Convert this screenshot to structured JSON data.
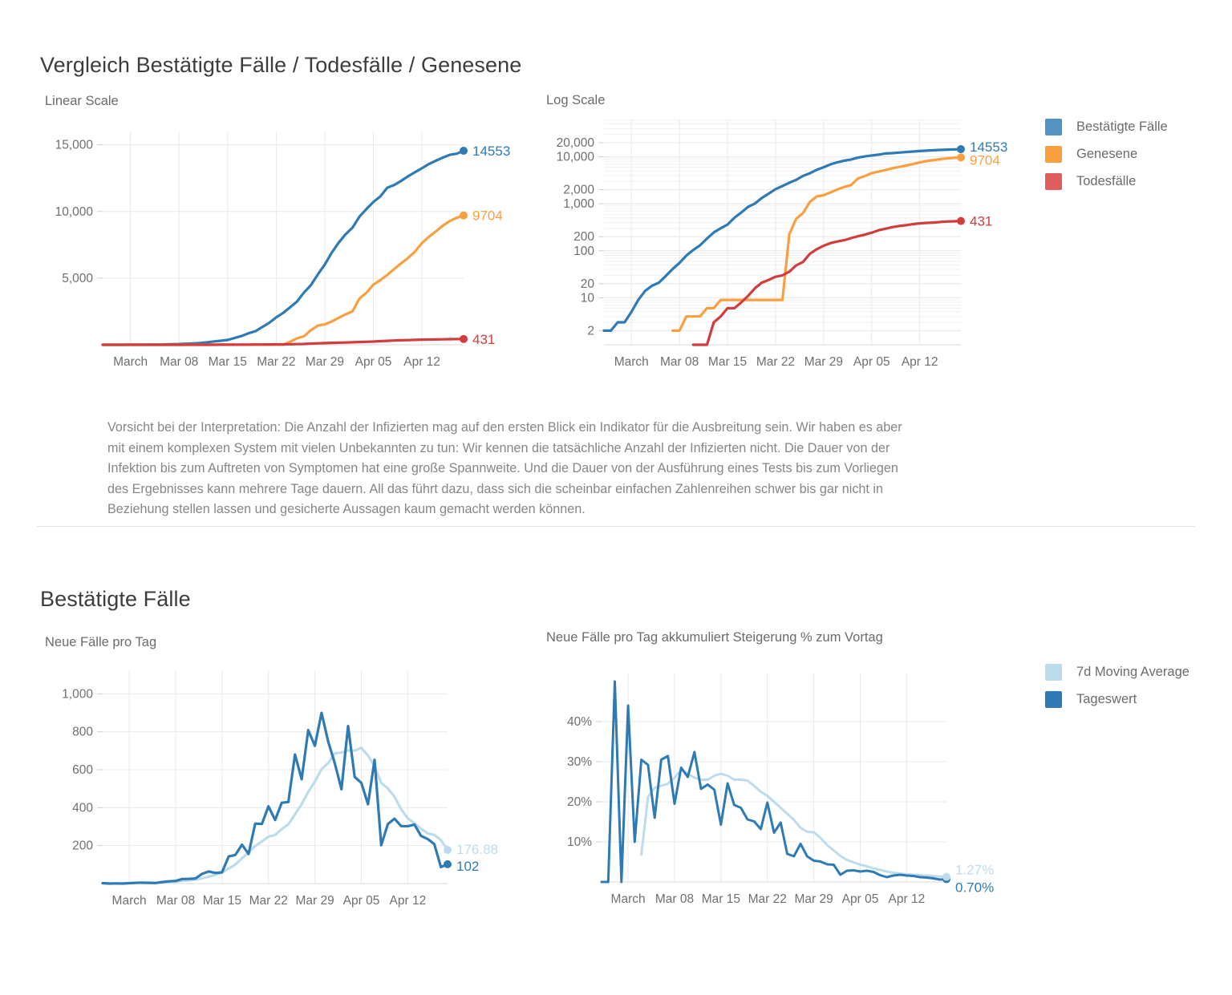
{
  "sections": {
    "compare": {
      "title": "Vergleich Bestätigte Fälle / Todesfälle / Genesene",
      "left_chart_caption": "Linear Scale",
      "right_chart_caption": "Log Scale",
      "note": "Vorsicht bei der Interpretation: Die Anzahl der Infizierten mag auf den ersten Blick ein Indikator für die Ausbreitung sein. Wir haben es aber mit einem komplexen System mit vielen Unbekannten zu tun: Wir kennen die tatsächliche Anzahl der Infizierten nicht. Die Dauer von der Infektion bis zum Auftreten von Symptomen hat eine große Spannweite. Und die Dauer von der Ausführung eines Tests bis zum Vorliegen des Ergebnisses kann mehrere Tage dauern. All das führt dazu, dass sich die scheinbar einfachen Zahlenreihen schwer bis gar nicht in Beziehung stellen lassen und gesicherte Aussagen kaum gemacht werden können.",
      "legend": [
        {
          "label": "Bestätigte Fälle",
          "color": "#5492c1"
        },
        {
          "label": "Genesene",
          "color": "#f9a košík"
        },
        {
          "label": "Todesfälle",
          "color": "#e05d5d"
        }
      ]
    },
    "confirmed": {
      "title": "Bestätigte Fälle",
      "left_chart_caption": "Neue Fälle pro Tag",
      "right_chart_caption": "Neue Fälle pro Tag akkumuliert Steigerung % zum Vortag",
      "legend": [
        {
          "label": "7d Moving Average",
          "color": "#bcdcec"
        },
        {
          "label": "Tageswert",
          "color": "#3d84b8"
        }
      ]
    }
  },
  "colors": {
    "confirmed": "#2e7ab4",
    "confirmed_legend": "#5492c1",
    "recovered": "#f99f3f",
    "deaths": "#d23c3c",
    "deaths_legend": "#e05d5d",
    "moving_avg": "#bcdcec",
    "daily": "#2e7ab4",
    "grid": "#e9e9e9",
    "text": "#6b6b6b"
  },
  "chart_data": [
    {
      "id": "linear-scale",
      "type": "line",
      "title": "Linear Scale",
      "xlabel": "",
      "ylabel": "",
      "ylim": [
        0,
        16000
      ],
      "yticks": [
        5000,
        10000,
        15000
      ],
      "ytick_labels": [
        "5,000",
        "10,000",
        "15,000"
      ],
      "xtick_labels": [
        "March",
        "Mar 08",
        "Mar 15",
        "Mar 22",
        "Mar 29",
        "Apr 05",
        "Apr 12"
      ],
      "xtick_index": [
        4,
        11,
        18,
        25,
        32,
        39,
        46
      ],
      "grid": true,
      "legend_position": "right-outside",
      "x_count": 53,
      "series": [
        {
          "name": "Bestätigte Fälle",
          "color": "#2e7ab4",
          "end_label": "14553",
          "values": [
            2,
            2,
            3,
            3,
            5,
            9,
            14,
            18,
            21,
            29,
            41,
            55,
            79,
            104,
            131,
            182,
            246,
            302,
            361,
            504,
            655,
            860,
            1016,
            1332,
            1646,
            2053,
            2388,
            2814,
            3244,
            3924,
            4474,
            5283,
            6009,
            6909,
            7657,
            8291,
            8788,
            9618,
            10180,
            10711,
            11129,
            11781,
            11983,
            12297,
            12639,
            12942,
            13244,
            13555,
            13806,
            14041,
            14249,
            14336,
            14553
          ]
        },
        {
          "name": "Genesene",
          "color": "#f99f3f",
          "end_label": "9704",
          "values": [
            0,
            0,
            0,
            0,
            0,
            0,
            0,
            0,
            0,
            0,
            2,
            2,
            4,
            4,
            4,
            6,
            6,
            9,
            9,
            9,
            9,
            9,
            9,
            9,
            9,
            9,
            9,
            225,
            479,
            636,
            1095,
            1436,
            1525,
            1749,
            2022,
            2284,
            2507,
            3463,
            3900,
            4512,
            4846,
            5240,
            5693,
            6104,
            6520,
            6987,
            7633,
            8098,
            8501,
            8932,
            9280,
            9524,
            9704
          ]
        },
        {
          "name": "Todesfälle",
          "color": "#d23c3c",
          "end_label": "431",
          "values": [
            0,
            0,
            0,
            0,
            0,
            0,
            0,
            0,
            0,
            0,
            0,
            0,
            0,
            1,
            1,
            1,
            3,
            4,
            6,
            6,
            8,
            11,
            16,
            21,
            24,
            28,
            30,
            36,
            49,
            58,
            86,
            108,
            128,
            146,
            158,
            168,
            186,
            204,
            220,
            243,
            273,
            295,
            319,
            337,
            350,
            368,
            384,
            393,
            399,
            410,
            419,
            425,
            431
          ]
        }
      ]
    },
    {
      "id": "log-scale",
      "type": "line",
      "title": "Log Scale",
      "xlabel": "",
      "ylabel": "",
      "yscale": "log",
      "ylim": [
        1,
        60000
      ],
      "yticks": [
        2,
        10,
        20,
        100,
        200,
        1000,
        2000,
        10000,
        20000
      ],
      "ytick_labels": [
        "2",
        "10",
        "20",
        "100",
        "200",
        "1,000",
        "2,000",
        "10,000",
        "20,000"
      ],
      "xtick_labels": [
        "March",
        "Mar 08",
        "Mar 15",
        "Mar 22",
        "Mar 29",
        "Apr 05",
        "Apr 12"
      ],
      "xtick_index": [
        4,
        11,
        18,
        25,
        32,
        39,
        46
      ],
      "grid": true,
      "legend_position": "right-outside",
      "x_count": 53,
      "series": [
        {
          "name": "Bestätigte Fälle",
          "color": "#2e7ab4",
          "end_label": "14553",
          "values": [
            2,
            2,
            3,
            3,
            5,
            9,
            14,
            18,
            21,
            29,
            41,
            55,
            79,
            104,
            131,
            182,
            246,
            302,
            361,
            504,
            655,
            860,
            1016,
            1332,
            1646,
            2053,
            2388,
            2814,
            3244,
            3924,
            4474,
            5283,
            6009,
            6909,
            7657,
            8291,
            8788,
            9618,
            10180,
            10711,
            11129,
            11781,
            11983,
            12297,
            12639,
            12942,
            13244,
            13555,
            13806,
            14041,
            14249,
            14336,
            14553
          ]
        },
        {
          "name": "Genesene",
          "color": "#f99f3f",
          "end_label": "9704",
          "values": [
            null,
            null,
            null,
            null,
            null,
            null,
            null,
            null,
            null,
            null,
            2,
            2,
            4,
            4,
            4,
            6,
            6,
            9,
            9,
            9,
            9,
            9,
            9,
            9,
            9,
            9,
            9,
            225,
            479,
            636,
            1095,
            1436,
            1525,
            1749,
            2022,
            2284,
            2507,
            3463,
            3900,
            4512,
            4846,
            5240,
            5693,
            6104,
            6520,
            6987,
            7633,
            8098,
            8501,
            8932,
            9280,
            9524,
            9704
          ]
        },
        {
          "name": "Todesfälle",
          "color": "#d23c3c",
          "end_label": "431",
          "values": [
            null,
            null,
            null,
            null,
            null,
            null,
            null,
            null,
            null,
            null,
            null,
            null,
            null,
            1,
            1,
            1,
            3,
            4,
            6,
            6,
            8,
            11,
            16,
            21,
            24,
            28,
            30,
            36,
            49,
            58,
            86,
            108,
            128,
            146,
            158,
            168,
            186,
            204,
            220,
            243,
            273,
            295,
            319,
            337,
            350,
            368,
            384,
            393,
            399,
            410,
            419,
            425,
            431
          ]
        }
      ]
    },
    {
      "id": "new-cases-per-day",
      "type": "line",
      "title": "Neue Fälle pro Tag",
      "xlabel": "",
      "ylabel": "",
      "ylim": [
        0,
        1120
      ],
      "yticks": [
        200,
        400,
        600,
        800,
        1000
      ],
      "ytick_labels": [
        "200",
        "400",
        "600",
        "800",
        "1,000"
      ],
      "xtick_labels": [
        "March",
        "Mar 08",
        "Mar 15",
        "Mar 22",
        "Mar 29",
        "Apr 05",
        "Apr 12"
      ],
      "xtick_index": [
        4,
        11,
        18,
        25,
        32,
        39,
        46
      ],
      "grid": true,
      "legend_position": "right-outside",
      "x_count": 53,
      "series": [
        {
          "name": "Tageswert",
          "color": "#2e7ab4",
          "end_label": "102",
          "values": [
            2,
            0,
            1,
            0,
            2,
            4,
            5,
            4,
            3,
            8,
            12,
            14,
            24,
            25,
            27,
            51,
            64,
            56,
            59,
            143,
            151,
            205,
            156,
            316,
            314,
            407,
            335,
            426,
            430,
            680,
            550,
            809,
            726,
            900,
            748,
            634,
            497,
            830,
            562,
            531,
            418,
            652,
            202,
            314,
            342,
            303,
            302,
            311,
            251,
            235,
            208,
            87,
            102
          ]
        },
        {
          "name": "7d Moving Average",
          "color": "#bcdcec",
          "end_label": "176.88",
          "values": [
            null,
            null,
            null,
            null,
            null,
            null,
            2.57,
            3.43,
            4.43,
            7.29,
            8.71,
            10.14,
            13.57,
            17.14,
            20.43,
            27.43,
            36.14,
            45.86,
            58.43,
            78.43,
            100.71,
            133.43,
            163.43,
            198.0,
            221.57,
            247.43,
            256.14,
            287.0,
            312.29,
            365.29,
            418.71,
            483.71,
            537.29,
            603.43,
            634.71,
            686.57,
            690.57,
            701.86,
            700.57,
            715.43,
            674.86,
            617.71,
            530.43,
            501.29,
            457.43,
            392.29,
            344.0,
            318.0,
            289.29,
            265.14,
            256.0,
            229.43,
            176.88
          ]
        }
      ]
    },
    {
      "id": "daily-increase-percent",
      "type": "line",
      "title": "Neue Fälle pro Tag akkumuliert Steigerung % zum Vortag",
      "xlabel": "",
      "ylabel": "",
      "ylim": [
        0,
        52
      ],
      "yticks": [
        10,
        20,
        30,
        40
      ],
      "ytick_labels": [
        "10%",
        "20%",
        "30%",
        "40%"
      ],
      "xtick_labels": [
        "March",
        "Mar 08",
        "Mar 15",
        "Mar 22",
        "Mar 29",
        "Apr 05",
        "Apr 12"
      ],
      "xtick_index": [
        4,
        11,
        18,
        25,
        32,
        39,
        46
      ],
      "grid": true,
      "legend_position": "right-outside",
      "x_count": 53,
      "series": [
        {
          "name": "Tageswert",
          "color": "#2e7ab4",
          "end_label": "0.70%",
          "values": [
            0,
            0,
            50.0,
            0,
            44.0,
            10.0,
            30.5,
            29.2,
            16.0,
            30.5,
            31.4,
            19.5,
            28.5,
            26.2,
            32.4,
            23.2,
            24.3,
            23.0,
            14.3,
            24.6,
            19.2,
            18.5,
            15.6,
            15.1,
            13.2,
            19.8,
            12.3,
            14.8,
            7.0,
            6.4,
            9.5,
            6.4,
            5.3,
            5.1,
            4.4,
            4.3,
            1.8,
            2.8,
            2.9,
            2.6,
            2.8,
            2.5,
            1.7,
            1.2,
            1.6,
            1.8,
            1.6,
            1.5,
            1.2,
            1.1,
            0.9,
            0.6,
            0.7
          ]
        },
        {
          "name": "7d Moving Average",
          "color": "#bcdcec",
          "end_label": "1.27%",
          "values": [
            null,
            null,
            null,
            null,
            null,
            null,
            6.8,
            21.2,
            23.5,
            24.0,
            24.5,
            26.0,
            28.0,
            27.0,
            26.0,
            25.5,
            25.5,
            26.5,
            27.0,
            26.5,
            25.5,
            25.5,
            25.3,
            24.0,
            22.5,
            21.5,
            20.0,
            18.5,
            17.0,
            15.5,
            13.5,
            12.5,
            12.4,
            11.0,
            9.2,
            7.9,
            6.5,
            5.5,
            4.9,
            4.3,
            3.9,
            3.4,
            3.0,
            2.6,
            2.3,
            2.1,
            1.9,
            1.8,
            1.7,
            1.6,
            1.5,
            1.38,
            1.27
          ]
        }
      ]
    }
  ]
}
